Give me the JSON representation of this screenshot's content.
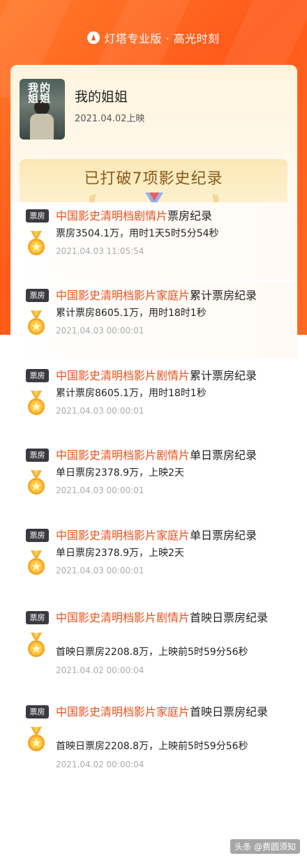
{
  "header": {
    "title": "灯塔专业版 · 高光时刻"
  },
  "movie": {
    "poster_text": "我的姐姐",
    "title": "我的姐姐",
    "release": "2021.04.02上映"
  },
  "banner": {
    "title": "已打破7项影史纪录"
  },
  "records": [
    {
      "badge": "票房",
      "highlight": "中国影史清明档剧情片",
      "suffix": "票房纪录",
      "desc": "票房3504.1万，用时1天5时5分54秒",
      "time": "2021.04.03 11:05:54"
    },
    {
      "badge": "票房",
      "highlight": "中国影史清明档影片家庭片",
      "suffix": "累计票房纪录",
      "desc": "累计票房8605.1万，用时18时1秒",
      "time": "2021.04.03 00:00:01"
    },
    {
      "badge": "票房",
      "highlight": "中国影史清明档影片剧情片",
      "suffix": "累计票房纪录",
      "desc": "累计票房8605.1万，用时18时1秒",
      "time": "2021.04.03 00:00:01"
    },
    {
      "badge": "票房",
      "highlight": "中国影史清明档影片剧情片",
      "suffix": "单日票房纪录",
      "desc": "单日票房2378.9万，上映2天",
      "time": "2021.04.03 00:00:01"
    },
    {
      "badge": "票房",
      "highlight": "中国影史清明档影片家庭片",
      "suffix": "单日票房纪录",
      "desc": "单日票房2378.9万，上映2天",
      "time": "2021.04.03 00:00:01"
    },
    {
      "badge": "票房",
      "highlight": "中国影史清明档影片剧情片",
      "suffix": "首映日票房纪录",
      "desc": "首映日票房2208.8万，上映前5时59分56秒",
      "time": "2021.04.02 00:00:04"
    },
    {
      "badge": "票房",
      "highlight": "中国影史清明档影片家庭片",
      "suffix": "首映日票房纪录",
      "desc": "首映日票房2208.8万，上映前5时59分56秒",
      "time": "2021.04.02 00:00:04"
    }
  ],
  "watermark": "头条 @费圆须知",
  "colors": {
    "accent": "#ff5a1a",
    "highlight": "#e8501c",
    "gold": "#f5a623"
  }
}
